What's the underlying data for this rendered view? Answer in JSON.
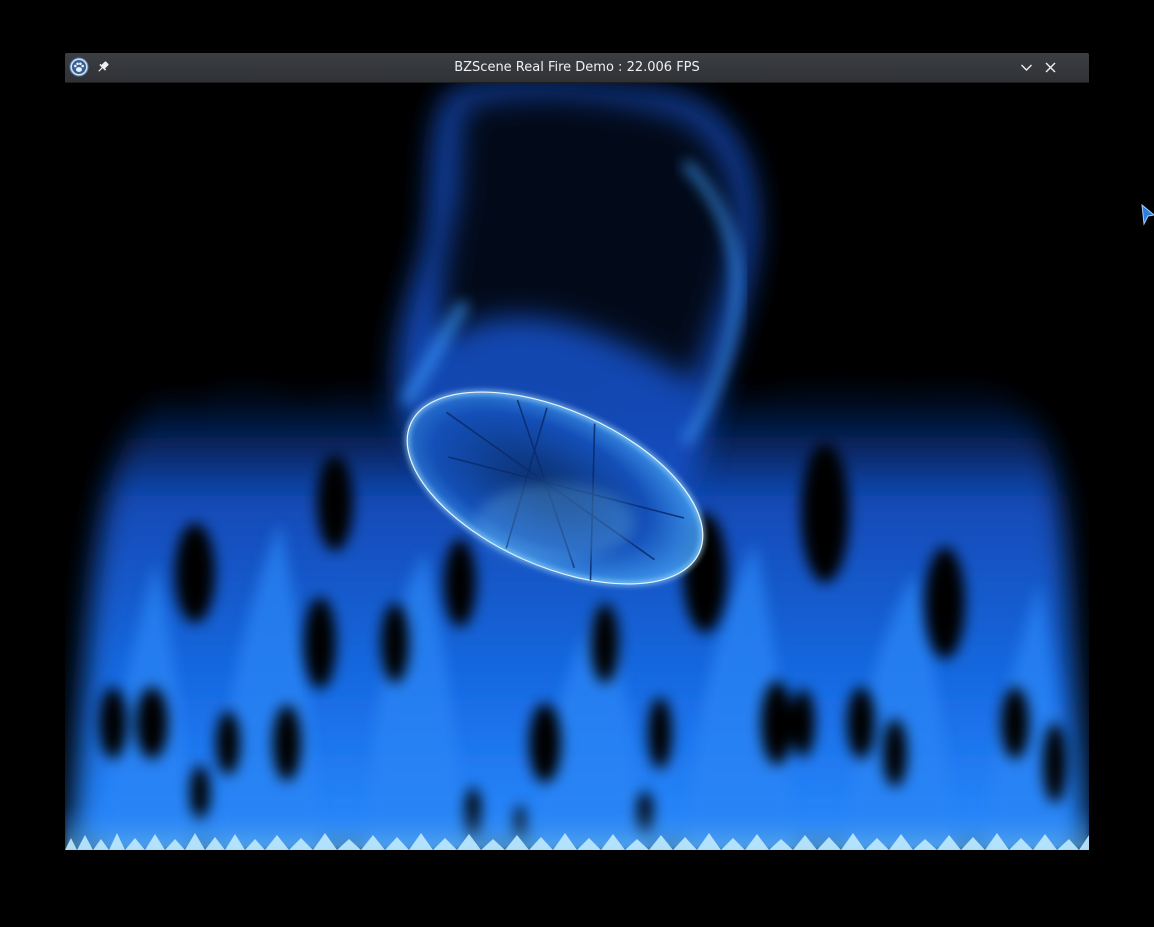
{
  "window": {
    "title": "BZScene Real Fire Demo : 22.006 FPS"
  },
  "titlebar": {
    "app_icon": "paw-icon",
    "pin_icon": "pin-icon",
    "minimize_icon": "chevron-down-icon",
    "close_icon": "close-icon"
  },
  "scene": {
    "description_icon": "fire-canvas",
    "flame_color": "#1a6fe8",
    "flame_highlight": "#6ec8ff",
    "background": "#000000"
  },
  "cursor_icon": "mouse-pointer-icon"
}
